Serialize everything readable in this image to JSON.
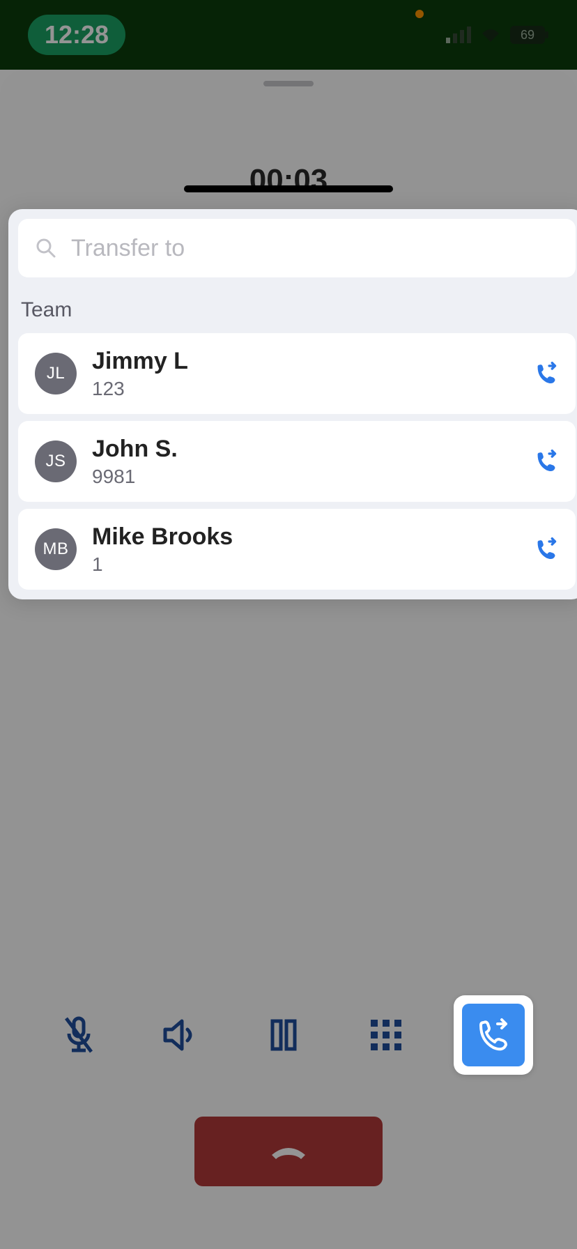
{
  "status": {
    "time": "12:28",
    "battery": "69"
  },
  "call": {
    "timer": "00:03"
  },
  "transfer": {
    "search_placeholder": "Transfer to",
    "section_label": "Team",
    "contacts": [
      {
        "initials": "JL",
        "name": "Jimmy L",
        "ext": "123"
      },
      {
        "initials": "JS",
        "name": "John S.",
        "ext": "9981"
      },
      {
        "initials": "MB",
        "name": "Mike Brooks",
        "ext": "1"
      }
    ]
  },
  "actions": {
    "mute": "mute",
    "speaker": "speaker",
    "hold": "hold",
    "keypad": "keypad",
    "transfer": "transfer",
    "hangup": "hangup"
  }
}
